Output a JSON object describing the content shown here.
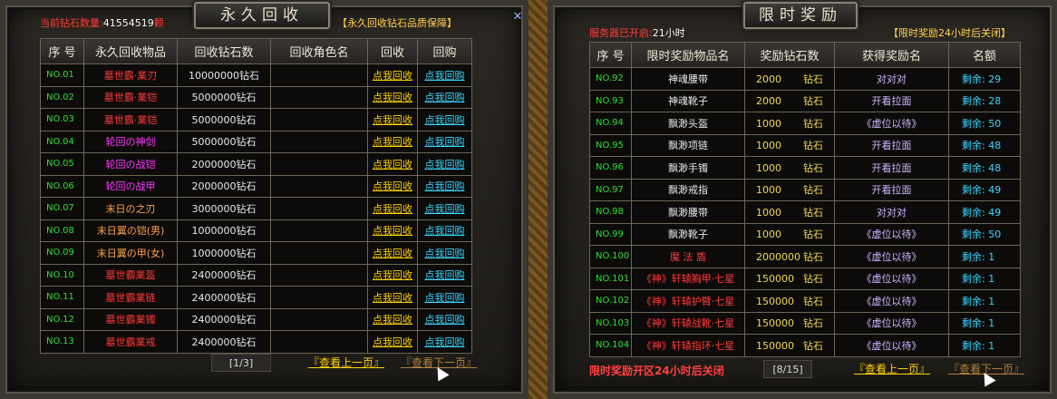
{
  "left": {
    "title": "永久回收",
    "diamond_label": "当前钻石数量:",
    "diamond_value": "41554519",
    "diamond_unit": "颗",
    "note": "【永久回收钻石品质保障】",
    "headers": [
      "序 号",
      "永久回收物品",
      "回收钻石数",
      "回收角色名",
      "回收",
      "回购"
    ],
    "recycle_label": "点我回收",
    "buyback_label": "点我回购",
    "rows": [
      {
        "no": "NO.01",
        "item": "墓世霸·業刃",
        "color": "#ff3a3a",
        "amount": "10000000",
        "unit": "钻石"
      },
      {
        "no": "NO.02",
        "item": "墓世霸·業铠",
        "color": "#ff3a3a",
        "amount": "5000000",
        "unit": "钻石"
      },
      {
        "no": "NO.03",
        "item": "墓世霸·業铠",
        "color": "#ff3a3a",
        "amount": "5000000",
        "unit": "钻石"
      },
      {
        "no": "NO.04",
        "item": "轮回の神剑",
        "color": "#ff3aff",
        "amount": "5000000",
        "unit": "钻石"
      },
      {
        "no": "NO.05",
        "item": "轮回の战铠",
        "color": "#ff3aff",
        "amount": "2000000",
        "unit": "钻石"
      },
      {
        "no": "NO.06",
        "item": "轮回の战甲",
        "color": "#ff3aff",
        "amount": "2000000",
        "unit": "钻石"
      },
      {
        "no": "NO.07",
        "item": "末日の之刃",
        "color": "#ffa24a",
        "amount": "3000000",
        "unit": "钻石"
      },
      {
        "no": "NO.08",
        "item": "末日翼の铠(男)",
        "color": "#ffa24a",
        "amount": "1000000",
        "unit": "钻石"
      },
      {
        "no": "NO.09",
        "item": "末日翼の甲(女)",
        "color": "#ffa24a",
        "amount": "1000000",
        "unit": "钻石"
      },
      {
        "no": "NO.10",
        "item": "墓世霸業盔",
        "color": "#ff3a3a",
        "amount": "2400000",
        "unit": "钻石"
      },
      {
        "no": "NO.11",
        "item": "墓世霸業链",
        "color": "#ff3a3a",
        "amount": "2400000",
        "unit": "钻石"
      },
      {
        "no": "NO.12",
        "item": "墓世霸業镯",
        "color": "#ff3a3a",
        "amount": "2400000",
        "unit": "钻石"
      },
      {
        "no": "NO.13",
        "item": "墓世霸業戒",
        "color": "#ff3a3a",
        "amount": "2400000",
        "unit": "钻石"
      }
    ],
    "page": "[1/3]",
    "prev": "『查看上一页』",
    "next": "『查看下一页』"
  },
  "right": {
    "title": "限时奖励",
    "server_label": "服务器已开启:",
    "server_value": "21",
    "server_unit": "小时",
    "note": "【限时奖励24小时后关闭】",
    "headers": [
      "序 号",
      "限时奖励物品名",
      "奖励钻石数",
      "获得奖励名",
      "名额"
    ],
    "rows": [
      {
        "no": "NO.92",
        "item": "神魂腰带",
        "color": "#e8e8e8",
        "amount": "2000",
        "unit": "钻石",
        "reward": "对对对",
        "remain": "剩余: 29"
      },
      {
        "no": "NO.93",
        "item": "神魂靴子",
        "color": "#e8e8e8",
        "amount": "2000",
        "unit": "钻石",
        "reward": "开看拉面",
        "remain": "剩余: 28"
      },
      {
        "no": "NO.94",
        "item": "飘渺头盔",
        "color": "#e8e8e8",
        "amount": "1000",
        "unit": "钻石",
        "reward": "《虚位以待》",
        "remain": "剩余: 50"
      },
      {
        "no": "NO.95",
        "item": "飘渺项链",
        "color": "#e8e8e8",
        "amount": "1000",
        "unit": "钻石",
        "reward": "开看拉面",
        "remain": "剩余: 48"
      },
      {
        "no": "NO.96",
        "item": "飘渺手镯",
        "color": "#e8e8e8",
        "amount": "1000",
        "unit": "钻石",
        "reward": "开看拉面",
        "remain": "剩余: 48"
      },
      {
        "no": "NO.97",
        "item": "飘渺戒指",
        "color": "#e8e8e8",
        "amount": "1000",
        "unit": "钻石",
        "reward": "开看拉面",
        "remain": "剩余: 49"
      },
      {
        "no": "NO.98",
        "item": "飘渺腰带",
        "color": "#e8e8e8",
        "amount": "1000",
        "unit": "钻石",
        "reward": "对对对",
        "remain": "剩余: 49"
      },
      {
        "no": "NO.99",
        "item": "飘渺靴子",
        "color": "#e8e8e8",
        "amount": "1000",
        "unit": "钻石",
        "reward": "《虚位以待》",
        "remain": "剩余: 50"
      },
      {
        "no": "NO.100",
        "item": "魔 法 盾",
        "color": "#ff3a3a",
        "amount": "2000000",
        "unit": "钻石",
        "reward": "《虚位以待》",
        "remain": "剩余: 1"
      },
      {
        "no": "NO.101",
        "item": "《神》轩辕胸甲·七星",
        "color": "#ff3a3a",
        "amount": "150000",
        "unit": "钻石",
        "reward": "《虚位以待》",
        "remain": "剩余: 1"
      },
      {
        "no": "NO.102",
        "item": "《神》轩辕护臂·七星",
        "color": "#ff3a3a",
        "amount": "150000",
        "unit": "钻石",
        "reward": "《虚位以待》",
        "remain": "剩余: 1"
      },
      {
        "no": "NO.103",
        "item": "《神》轩辕战靴·七星",
        "color": "#ff3a3a",
        "amount": "150000",
        "unit": "钻石",
        "reward": "《虚位以待》",
        "remain": "剩余: 1"
      },
      {
        "no": "NO.104",
        "item": "《神》轩辕指环·七星",
        "color": "#ff3a3a",
        "amount": "150000",
        "unit": "钻石",
        "reward": "《虚位以待》",
        "remain": "剩余: 1"
      }
    ],
    "footer": "限时奖励开区24小时后关闭",
    "page": "[8/15]",
    "prev": "『查看上一页』",
    "next": "『查看下一页』"
  },
  "colors": {
    "accent_red": "#ff3a3a",
    "accent_gold": "#ffd200",
    "accent_cyan": "#3ad6ff",
    "number_green": "#2fe02f"
  }
}
